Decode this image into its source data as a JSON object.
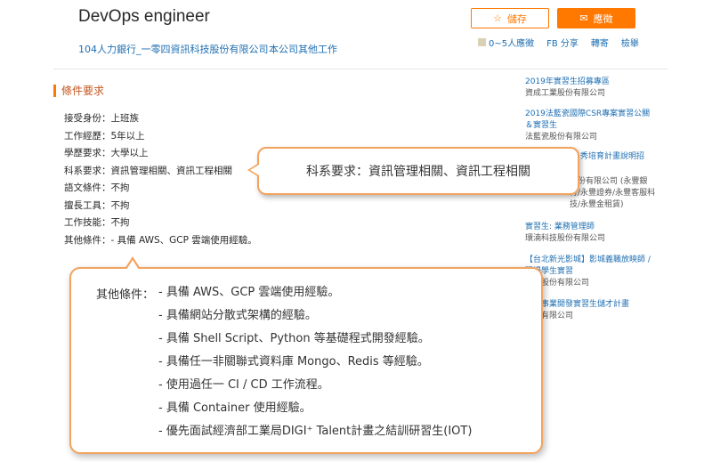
{
  "header": {
    "job_title": "DevOps engineer",
    "company": "104人力銀行_一零四資訊科技股份有限公司",
    "other_jobs": "本公司其他工作",
    "save_label": "儲存",
    "apply_label": "應徵",
    "applicants": "0~5人應徵",
    "share": "FB 分享",
    "forward": "轉寄",
    "report": "檢舉"
  },
  "requirements": {
    "section_title": "條件要求",
    "rows": [
      {
        "label": "接受身份：",
        "value": "上班族"
      },
      {
        "label": "工作經歷：",
        "value": "5年以上"
      },
      {
        "label": "學歷要求：",
        "value": "大學以上"
      },
      {
        "label": "科系要求：",
        "value": "資訊管理相關、資訊工程相關"
      },
      {
        "label": "語文條件：",
        "value": "不拘"
      },
      {
        "label": "擅長工具：",
        "value": "不拘"
      },
      {
        "label": "工作技能：",
        "value": "不拘"
      },
      {
        "label": "其他條件：",
        "value": "- 具備 AWS、GCP 雲端使用經驗。"
      }
    ]
  },
  "sidebar": {
    "items": [
      {
        "job": "2019年實習生招募專區",
        "company": "資成工業股份有限公司"
      },
      {
        "job": "2019法藍瓷國際CSR專案實習公關＆實習生",
        "company": "法藍瓷股份有限公司"
      },
      {
        "job": "秀培育計畫說明招",
        "company": "股份有限公司 (永豐銀行/永豐證券/永豐客服科技/永豐金租賃)"
      },
      {
        "job": "實習生: 業務管理師",
        "company": "環湳科技股份有限公司"
      },
      {
        "job": "【台北新光影城】影城義職放映師 / 現場學生實習",
        "company": "影城股份有限公司"
      },
      {
        "job": "北】事業開發實習生儲才計畫",
        "company": "電壹有限公司"
      }
    ]
  },
  "callouts": {
    "major": "科系要求：資訊管理相關、資訊工程相關",
    "other_label": "其他條件：",
    "other_lines": [
      "- 具備 AWS、GCP 雲端使用經驗。",
      "- 具備網站分散式架構的經驗。",
      "- 具備 Shell Script、Python 等基礎程式開發經驗。",
      "- 具備任一非關聯式資料庫 Mongo、Redis 等經驗。",
      "- 使用過任一 CI / CD 工作流程。",
      "- 具備 Container 使用經驗。",
      "- 優先面試經濟部工業局DIGI⁺ Talent計畫之結訓研習生(IOT)"
    ]
  },
  "colors": {
    "accent": "#ff7800",
    "link": "#1f6fb2",
    "callout_border": "#f2a35e"
  }
}
